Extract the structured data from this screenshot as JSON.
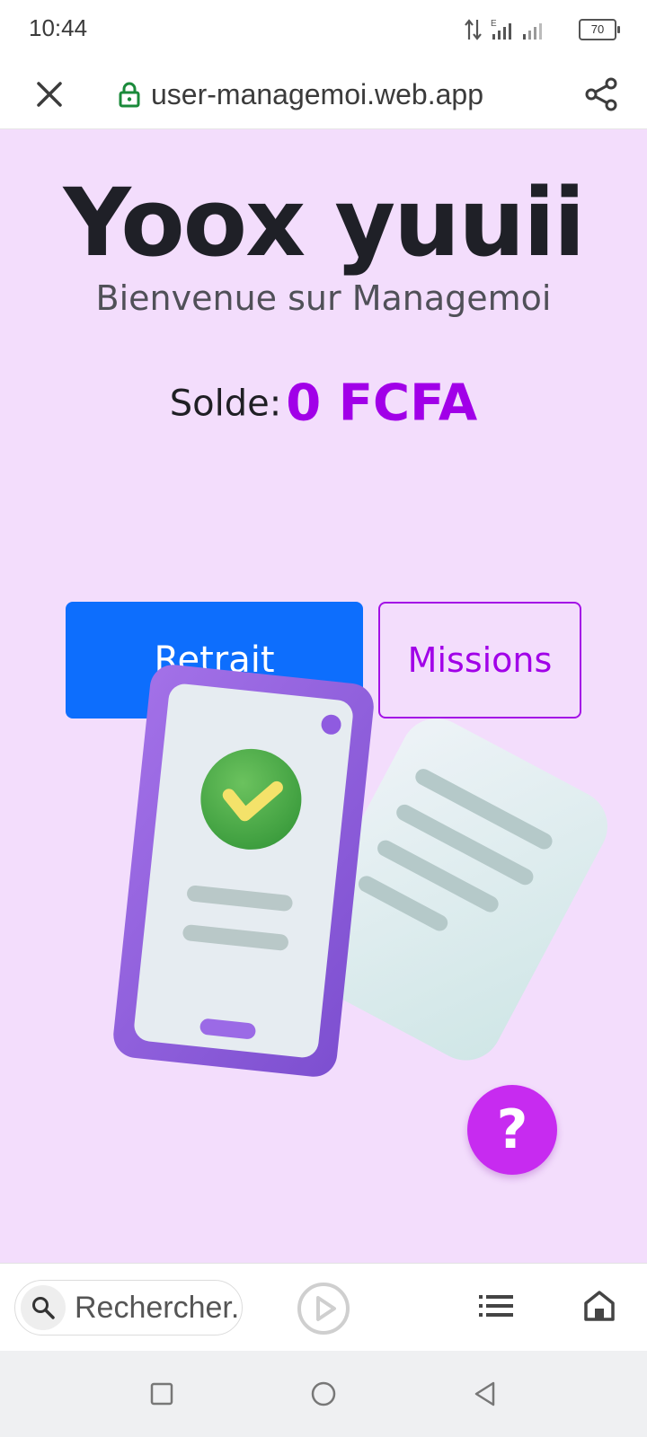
{
  "status_bar": {
    "time": "10:44",
    "battery": "70"
  },
  "browser": {
    "url": "user-managemoi.web.app"
  },
  "page": {
    "title": "Yoox yuuii",
    "subtitle": "Bienvenue sur Managemoi",
    "balance_label": "Solde:",
    "balance_value": "0 FCFA",
    "withdraw_label": "Retrait",
    "missions_label": "Missions",
    "help_label": "?"
  },
  "toolbar": {
    "search_placeholder": "Rechercher..."
  },
  "colors": {
    "page_bg": "#f3ddfc",
    "accent_purple": "#a100e8",
    "primary_blue": "#0d6efd",
    "help_fab": "#c72bf0"
  },
  "icons": [
    "close-icon",
    "lock-icon",
    "share-icon",
    "search-icon",
    "play-icon",
    "list-icon",
    "home-icon",
    "square-icon",
    "circle-icon",
    "back-triangle-icon"
  ]
}
